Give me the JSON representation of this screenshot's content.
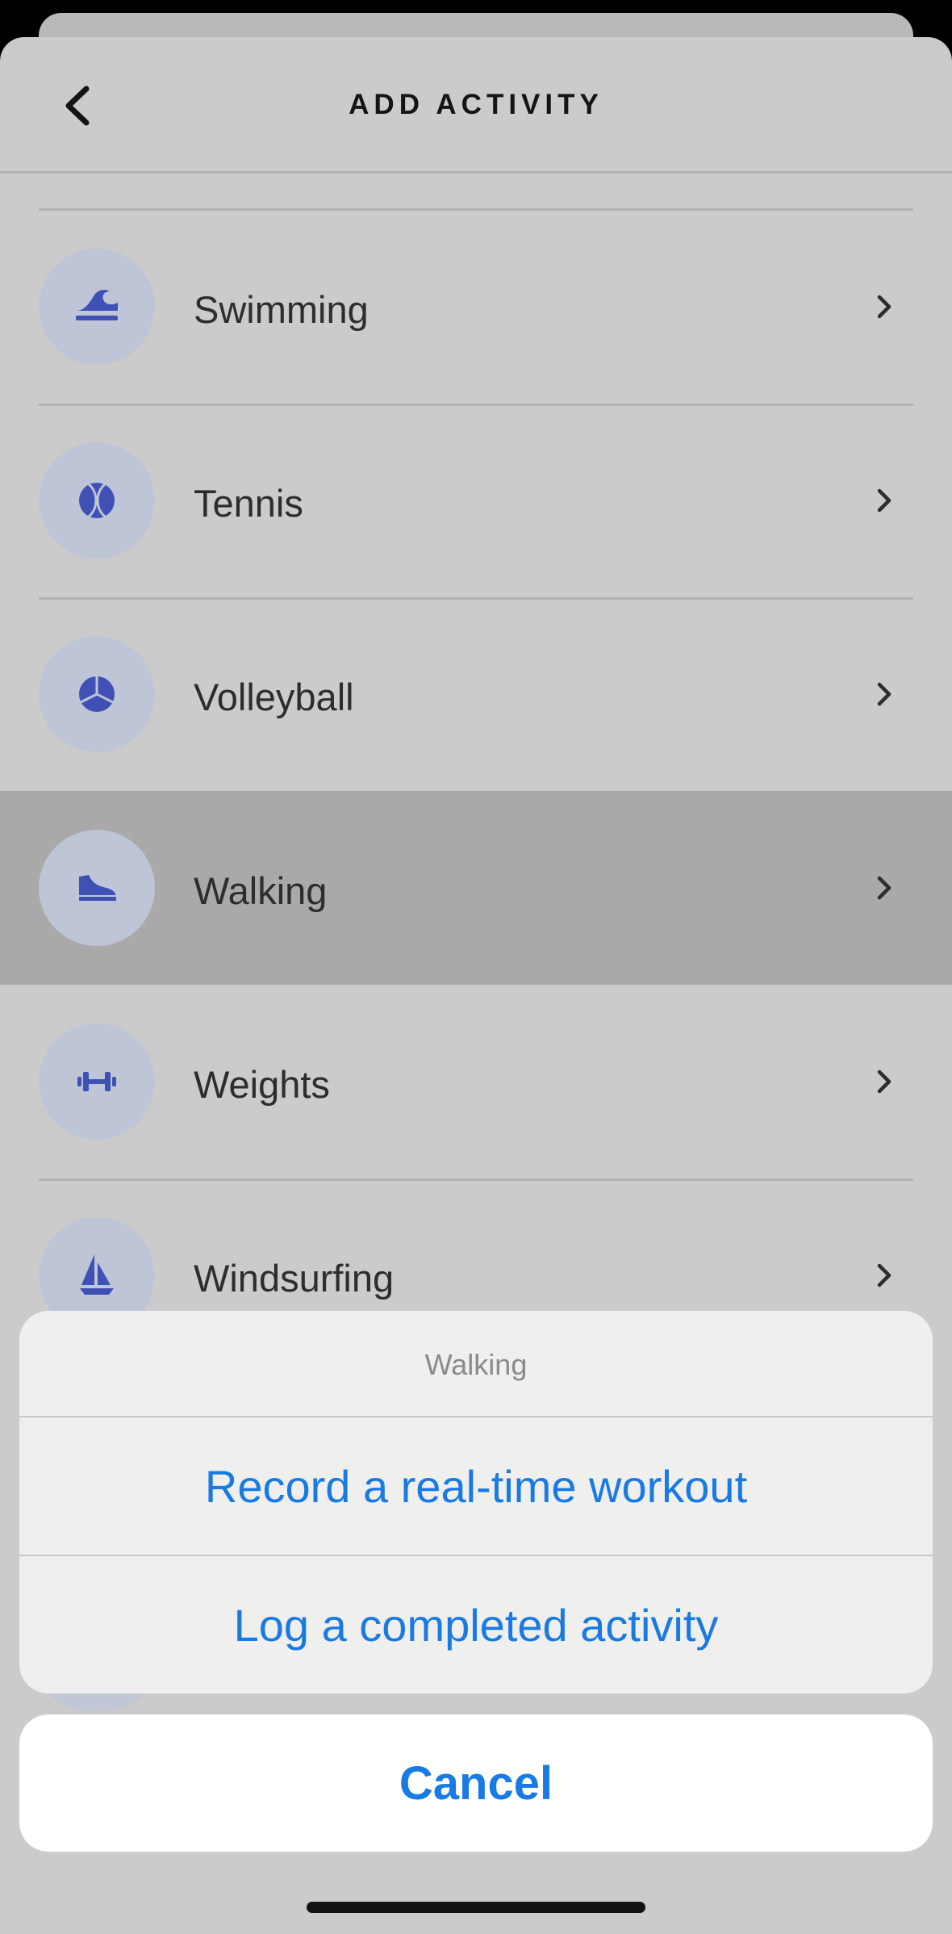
{
  "header": {
    "title": "ADD ACTIVITY",
    "back_icon": "chevron-left-icon"
  },
  "activities": [
    {
      "label": "Swimming",
      "icon": "swimming-icon"
    },
    {
      "label": "Tennis",
      "icon": "tennis-ball-icon"
    },
    {
      "label": "Volleyball",
      "icon": "volleyball-icon"
    },
    {
      "label": "Walking",
      "icon": "sneaker-icon",
      "highlighted": true
    },
    {
      "label": "Weights",
      "icon": "dumbbell-icon"
    },
    {
      "label": "Windsurfing",
      "icon": "sailboat-icon"
    }
  ],
  "action_sheet": {
    "title": "Walking",
    "actions": [
      "Record a real-time workout",
      "Log a completed activity"
    ],
    "cancel": "Cancel"
  },
  "colors": {
    "accent": "#1a7ae3",
    "icon": "#3f51b5",
    "icon_bg": "#bec5d6",
    "highlight": "#a9a9a9"
  }
}
